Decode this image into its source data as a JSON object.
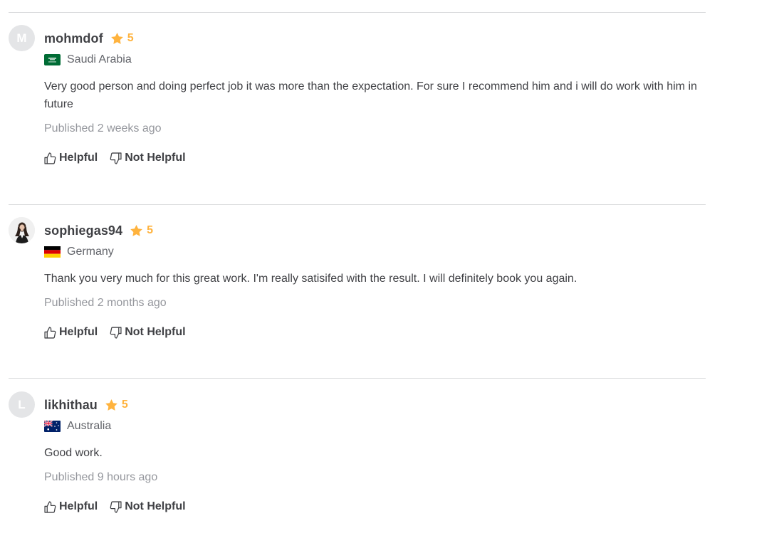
{
  "reviews": [
    {
      "avatar_initial": "M",
      "username": "mohmdof",
      "rating": "5",
      "country": "Saudi Arabia",
      "flag": "saudi-arabia-flag",
      "text": "Very good person and doing perfect job it was more than the expectation. For sure I recommend him and i will do work with him in future",
      "published": "Published 2 weeks ago",
      "helpful_label": "Helpful",
      "not_helpful_label": "Not Helpful"
    },
    {
      "avatar_initial": "",
      "username": "sophiegas94",
      "rating": "5",
      "country": "Germany",
      "flag": "germany-flag",
      "text": "Thank you very much for this great work. I'm really satisifed with the result. I will definitely book you again.",
      "published": "Published 2 months ago",
      "helpful_label": "Helpful",
      "not_helpful_label": "Not Helpful"
    },
    {
      "avatar_initial": "L",
      "username": "likhithau",
      "rating": "5",
      "country": "Australia",
      "flag": "australia-flag",
      "text": "Good work.",
      "published": "Published 9 hours ago",
      "helpful_label": "Helpful",
      "not_helpful_label": "Not Helpful"
    }
  ],
  "colors": {
    "star": "#ffb33e",
    "divider": "#dadbdd",
    "muted_text": "#95979d",
    "body_text": "#404145"
  }
}
